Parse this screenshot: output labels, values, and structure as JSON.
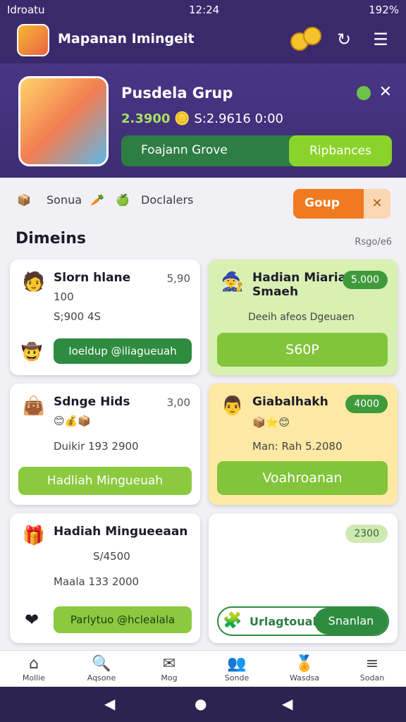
{
  "status": {
    "carrier": "Idroatu",
    "time": "12:24",
    "battery": "192%"
  },
  "app": {
    "title": "Mapanan Imingeit"
  },
  "hero": {
    "title": "Pusdela Grup",
    "stat_main": "2.3900",
    "stat_sub": "S:2.9616 0:00",
    "left_label": "Foajann Grove",
    "right_button": "Ripbances"
  },
  "categories": {
    "item1": "Sonua",
    "item2": "Doclalers",
    "group_button": "Goup"
  },
  "section": {
    "title": "Dimeins",
    "side": "Rsgo/e6"
  },
  "cards": [
    {
      "title": "Slorn hlane",
      "price": "5,90",
      "line1": "100",
      "line2": "S;900 4S",
      "button": "Ioeldup @iliagueuah"
    },
    {
      "title": "Hadian Miaria Smaeh",
      "badge": "5.000",
      "line1": "Deeih afeos Dgeuaen",
      "button": "S60P"
    },
    {
      "title": "Sdnge Hids",
      "price": "3,00",
      "line2": "Duikir 193 2900",
      "button": "Hadliah Mingueuah"
    },
    {
      "title": "Giabalhakh",
      "badge": "4000",
      "line2": "Man: Rah 5.2080",
      "button": "Voahroanan"
    },
    {
      "title": "Hadiah Mingueeaan",
      "line1": "S/4500",
      "line2": "Maala 133 2000",
      "button": "Parlytuo @hclealala"
    },
    {
      "badge": "2300",
      "left_label": "Urlagtoual",
      "right_button": "Snanlan"
    }
  ],
  "nav": [
    "Mollie",
    "Aqsone",
    "Mog",
    "Sonde",
    "Wasdsa",
    "Sodan"
  ]
}
